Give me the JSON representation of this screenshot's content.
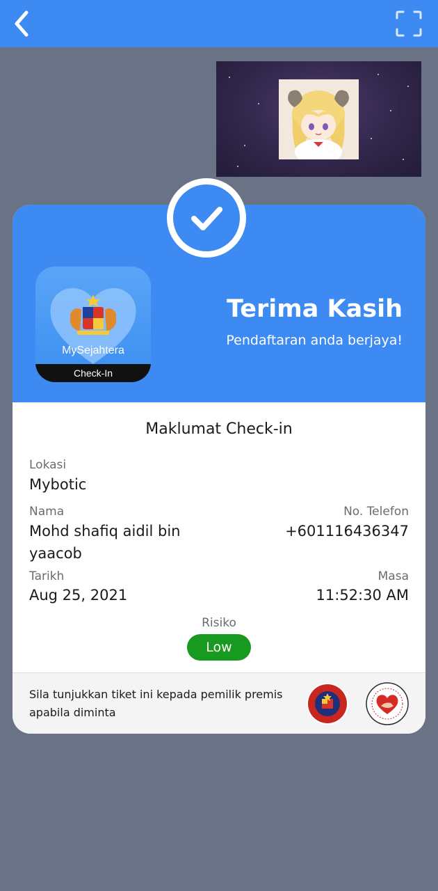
{
  "topbar": {
    "background": "#3d8bf2",
    "back_icon": "chevron-left-icon",
    "scan_icon": "fullscreen-scan-icon"
  },
  "video_tile": {
    "content": "anime-avatar"
  },
  "card": {
    "header": {
      "app_logo": {
        "name": "MySejahtera",
        "band": "Check-In"
      },
      "title": "Terima Kasih",
      "subtitle": "Pendaftaran anda berjaya!",
      "status_icon": "checkmark-icon"
    },
    "section_title": "Maklumat Check-in",
    "fields": {
      "lokasi_label": "Lokasi",
      "lokasi_value": "Mybotic",
      "nama_label": "Nama",
      "nama_value": "Mohd shafiq aidil bin yaacob",
      "telefon_label": "No. Telefon",
      "telefon_value": "+601116436347",
      "tarikh_label": "Tarikh",
      "tarikh_value": "Aug 25, 2021",
      "masa_label": "Masa",
      "masa_value": "11:52:30 AM",
      "risiko_label": "Risiko",
      "risiko_value": "Low"
    },
    "footer": {
      "text": "Sila tunjukkan tiket ini kepada pemilik premis apabila diminta",
      "seal_1": "nsc-malaysia-seal",
      "seal_2": "kementerian-kesihatan-malaysia-seal"
    }
  },
  "colors": {
    "accent": "#3d8bf2",
    "risk_low": "#18991f",
    "page_background": "#6a7385"
  }
}
